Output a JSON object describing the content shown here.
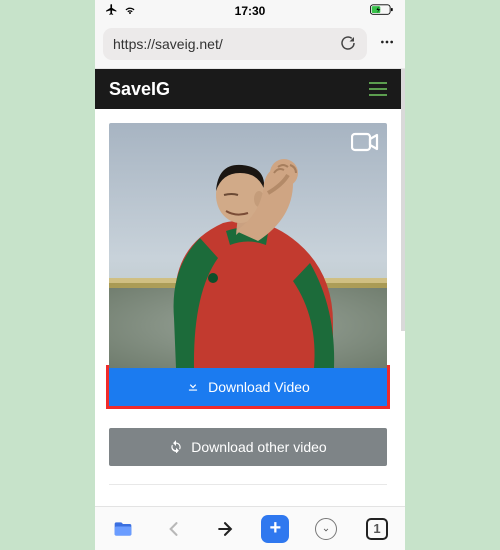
{
  "status": {
    "time": "17:30"
  },
  "browser": {
    "url": "https://saveig.net/",
    "tab_count": "1"
  },
  "app": {
    "brand": "SaveIG",
    "download_video_label": "Download Video",
    "download_other_label": "Download other video"
  }
}
